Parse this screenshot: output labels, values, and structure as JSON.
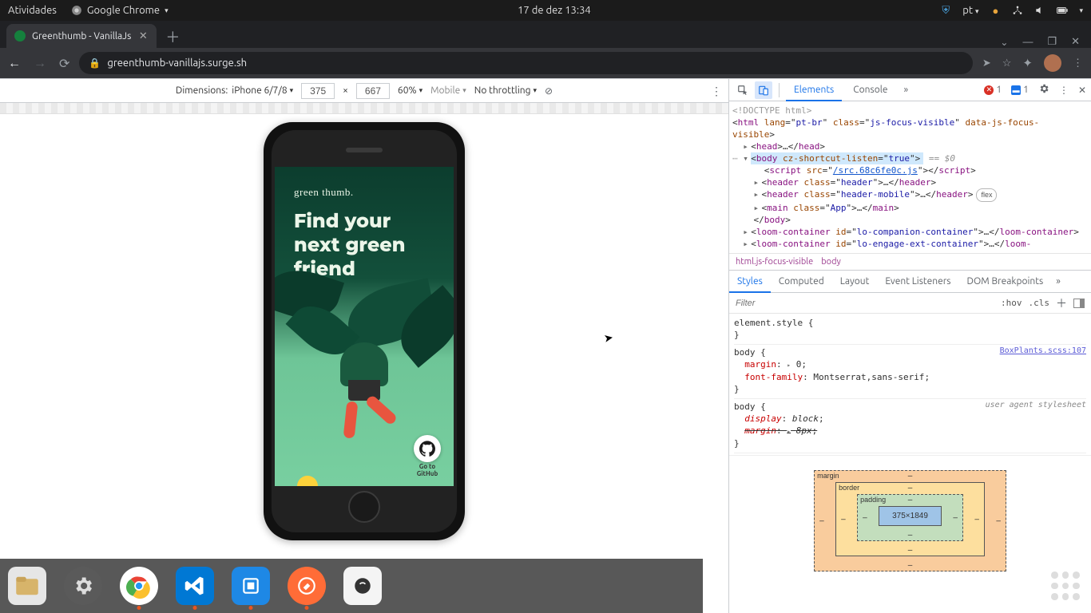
{
  "ubuntu": {
    "activities": "Atividades",
    "app_name": "Google Chrome",
    "datetime": "17 de dez  13:34",
    "lang_indicator": "pt"
  },
  "chrome": {
    "tab_title": "Greenthumb - VanillaJs",
    "url": "greenthumb-vanillajs.surge.sh"
  },
  "device_toolbar": {
    "dimensions_label": "Dimensions:",
    "device": "iPhone 6/7/8",
    "width": "375",
    "height": "667",
    "times": "×",
    "zoom": "60%",
    "mobile": "Mobile",
    "throttling": "No throttling"
  },
  "page": {
    "brand": "green thumb.",
    "hero": "Find your next green friend",
    "gh_line1": "Go to",
    "gh_line2": "GitHub"
  },
  "devtools": {
    "tabs": {
      "elements": "Elements",
      "console": "Console"
    },
    "errors_count": "1",
    "info_count": "1",
    "dom": {
      "doctype": "<!DOCTYPE html>",
      "html_open1": "<html lang=\"",
      "html_lang": "pt-br",
      "html_open2": "\" class=\"",
      "html_class": "js-focus-visible",
      "html_open3": "\" data-js-focus-visible>",
      "head": "<head>…</head>",
      "body_open1": "<body cz-shortcut-listen=\"",
      "body_attr_val": "true",
      "body_open2": "\">",
      "body_hint": " == $0",
      "script1a": "<script src=\"",
      "script1_src": "/src.68c6fe0c.js",
      "script1b": "\"></script>",
      "header1": "<header class=\"header\">…</header>",
      "header2a": "<header class=\"",
      "header2_class": "header-mobile",
      "header2b": "\">…</header>",
      "flex_badge": "flex",
      "main_a": "<main class=\"",
      "main_class": "App",
      "main_b": "\">…</main>",
      "body_close": "</body>",
      "loom1a": "<loom-container id=\"",
      "loom1_id": "lo-companion-container",
      "loom1b": "\">…</loom-container>",
      "loom2a": "<loom-container id=\"",
      "loom2_id": "lo-engage-ext-container",
      "loom2b": "\">…</loom-"
    },
    "breadcrumb": {
      "a": "html.js-focus-visible",
      "b": "body"
    },
    "styles_tabs": {
      "styles": "Styles",
      "computed": "Computed",
      "layout": "Layout",
      "event_listeners": "Event Listeners",
      "dom_breakpoints": "DOM Breakpoints"
    },
    "filter_placeholder": "Filter",
    "hov": ":hov",
    "cls": ".cls",
    "css": {
      "elstyle": "element.style {",
      "close": "}",
      "body_sel": "body {",
      "src1": "BoxPlants.scss:107",
      "margin_prop": "margin",
      "margin_val": "0",
      "ff_prop": "font-family",
      "ff_val": "Montserrat,sans-serif",
      "ua_label": "user agent stylesheet",
      "display_prop": "display",
      "display_val": "block",
      "margin2_prop": "margin",
      "margin2_val": "8px"
    },
    "boxmodel": {
      "margin": "margin",
      "border": "border",
      "padding": "padding",
      "content": "375×1849",
      "dash": "–"
    }
  },
  "dock": {
    "files": "files",
    "settings": "settings",
    "chrome": "chrome",
    "vscode": "vscode",
    "app_blue": "app",
    "postman": "postman",
    "app_other": "app"
  }
}
